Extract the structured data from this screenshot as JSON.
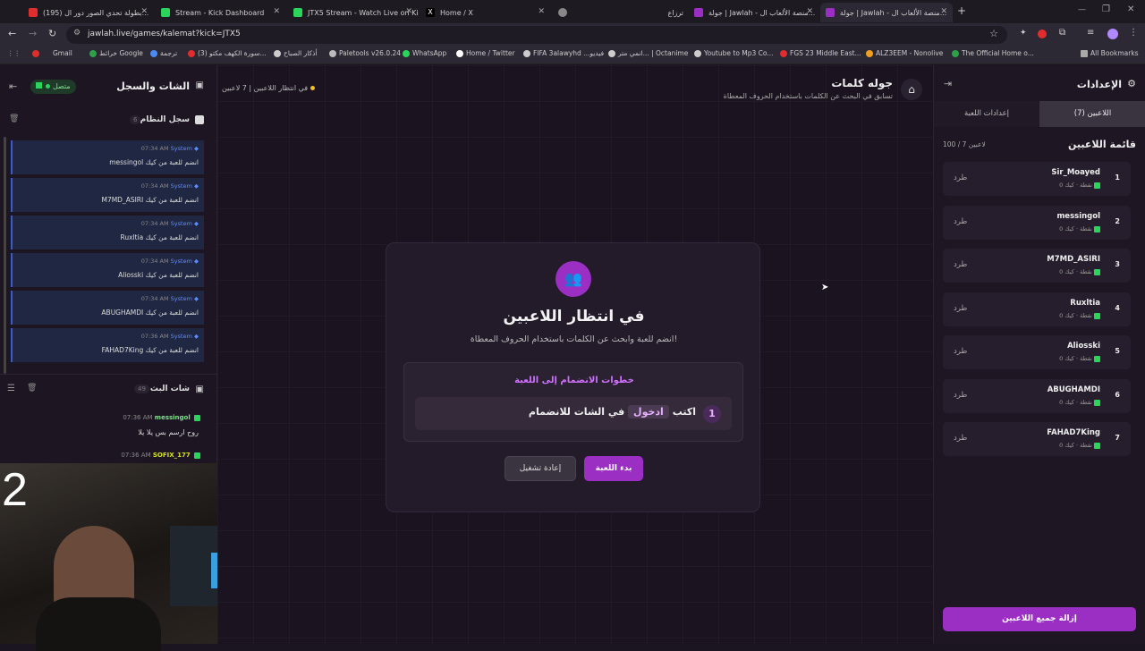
{
  "tabs": [
    {
      "title": "(195) بطولة تحدي الصور دور ال...",
      "color": "#e02d2d"
    },
    {
      "title": "Stream - Kick Dashboard",
      "color": "#2bd45a"
    },
    {
      "title": "JTX5 Stream - Watch Live on Ki...",
      "color": "#2bd45a"
    },
    {
      "title": "Home / X",
      "color": "#ffffff"
    },
    {
      "title": "",
      "color": "#888888"
    },
    {
      "title": "ترزاع",
      "color": "#888888"
    },
    {
      "title": "جولة | Jawlah - منصة الألعاب ال...",
      "color": "#888888"
    },
    {
      "title": "جولة | Jawlah - منصة الألعاب ال...",
      "color": "#888888"
    }
  ],
  "url": "jawlah.live/games/kalemat?kick=JTX5",
  "bookmarks": [
    "Gmail",
    "خرائط Google",
    "ترجمة",
    "(3) سورة الكهف مكتو...",
    "أذكار الصباح",
    "Paletools v26.0.24",
    "WhatsApp",
    "Home / Twitter",
    "FIFA 3alawyhd ...فيديو",
    "انمي متر... | Octanime",
    "Youtube to Mp3 Co...",
    "FGS 23 Middle East...",
    "ALZ3EEM - Nonolive",
    "The Official Home o...",
    "All Bookmarks"
  ],
  "left": {
    "title": "الشات والسجل",
    "status": "متصل",
    "system_log": {
      "title": "سجل النظام",
      "count": "6"
    },
    "system_messages": [
      {
        "sender": "System",
        "time": "07:34 AM",
        "text": "messingol انضم للعبة من كيك"
      },
      {
        "sender": "System",
        "time": "07:34 AM",
        "text": "M7MD_ASIRI انضم للعبة من كيك"
      },
      {
        "sender": "System",
        "time": "07:34 AM",
        "text": "Ruxltia انضم للعبة من كيك"
      },
      {
        "sender": "System",
        "time": "07:34 AM",
        "text": "Aliosski انضم للعبة من كيك"
      },
      {
        "sender": "System",
        "time": "07:34 AM",
        "text": "ABUGHAMDI انضم للعبة من كيك"
      },
      {
        "sender": "System",
        "time": "07:36 AM",
        "text": "FAHAD7King انضم للعبة من كيك"
      }
    ],
    "live_chat": {
      "title": "شات البث",
      "count": "49"
    },
    "chat_messages": [
      {
        "user": "messingol",
        "time": "07:36 AM",
        "text": "روح ارسم بس يلا يلا"
      },
      {
        "user": "SOFIX_177",
        "time": "07:36 AM",
        "text": ""
      }
    ],
    "webcam_overlay": "2"
  },
  "header": {
    "title": "جوله كلمات",
    "subtitle": "تسابق في البحث عن الكلمات باستخدام الحروف المعطاة",
    "players_count": "7 لاعبين",
    "status": "في انتظار اللاعبين"
  },
  "modal": {
    "title": "في انتظار اللاعبين",
    "subtitle": "انضم للعبة وابحث عن الكلمات باستخدام الحروف المعطاة!",
    "steps_title": "خطوات الانضمام إلى اللعبة",
    "step_number": "1",
    "step_prefix": "اكتب",
    "step_keyword": "ادخول",
    "step_suffix": "في الشات للانضمام",
    "start_label": "بدء اللعبة",
    "restart_label": "إعادة تشغيل"
  },
  "right": {
    "title": "الإعدادات",
    "tab_players": "اللاعبين (7)",
    "tab_settings": "إعدادات اللعبة",
    "list_title": "قائمة اللاعبين",
    "list_count": "100 / 7 لاعبين",
    "kick_label": "طرد",
    "player_sub": "0 نقطة · كيك",
    "players": [
      {
        "rank": "1",
        "name": "Sir_Moayed"
      },
      {
        "rank": "2",
        "name": "messingol"
      },
      {
        "rank": "3",
        "name": "M7MD_ASIRI"
      },
      {
        "rank": "4",
        "name": "Ruxltia"
      },
      {
        "rank": "5",
        "name": "Aliosski"
      },
      {
        "rank": "6",
        "name": "ABUGHAMDI"
      },
      {
        "rank": "7",
        "name": "FAHAD7King"
      }
    ],
    "remove_all": "إزالة جميع اللاعبين"
  },
  "colors": {
    "accent": "#9b2fc4",
    "kick_green": "#2bd45a",
    "system_blue": "#5c8cff"
  }
}
